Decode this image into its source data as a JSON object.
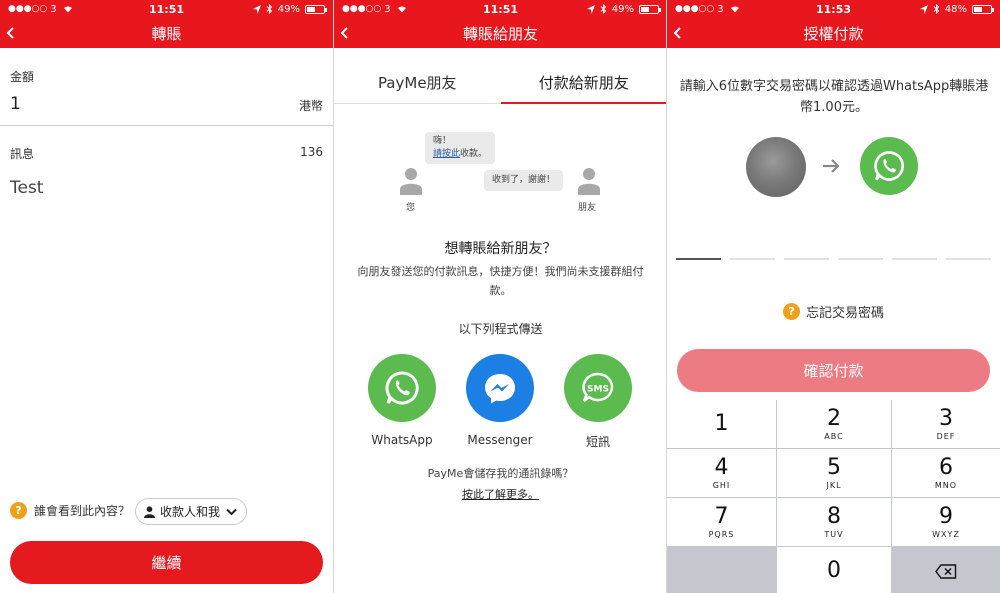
{
  "screens": [
    {
      "status": {
        "carrier": "3",
        "time": "11:51",
        "battery": "49%",
        "battery_level": 0.49
      },
      "nav_title": "轉賬",
      "amount_label": "金額",
      "amount_value": "1",
      "currency": "港幣",
      "message_label": "訊息",
      "char_count": "136",
      "message_value": "Test",
      "visibility_question": "誰會看到此內容？",
      "visibility_value": "收款人和我",
      "continue_label": "繼續"
    },
    {
      "status": {
        "carrier": "3",
        "time": "11:51",
        "battery": "49%",
        "battery_level": 0.49
      },
      "nav_title": "轉賬給朋友",
      "tabs": [
        {
          "label": "PayMe朋友",
          "active": false
        },
        {
          "label": "付款給新朋友",
          "active": true
        }
      ],
      "illustration": {
        "bubble1_line1": "嗨！",
        "bubble1_link": "請按此",
        "bubble1_rest": "收款。",
        "bubble2": "收到了，謝謝！",
        "you_label": "您",
        "friend_label": "朋友"
      },
      "heading": "想轉賬給新朋友？",
      "description": "向朋友發送您的付款訊息，快捷方便！我們尚未支援群組付款。",
      "send_via": "以下列程式傳送",
      "apps": [
        {
          "name": "WhatsApp",
          "color": "#5cbb4f",
          "icon": "whatsapp-icon"
        },
        {
          "name": "Messenger",
          "color": "#1b7fe3",
          "icon": "messenger-icon"
        },
        {
          "name": "短訊",
          "color": "#5cbb4f",
          "icon": "sms-icon",
          "badge": "SMS"
        }
      ],
      "contacts_question": "PayMe會儲存我的通訊錄嗎？",
      "learn_more": "按此了解更多。"
    },
    {
      "status": {
        "carrier": "3",
        "time": "11:53",
        "battery": "48%",
        "battery_level": 0.48
      },
      "nav_title": "授權付款",
      "prompt": "請輸入6位數字交易密碼以確認透過WhatsApp轉賬港幣1.00元。",
      "forgot": "忘記交易密碼",
      "confirm_label": "確認付款",
      "keys": [
        {
          "digit": "1",
          "letters": ""
        },
        {
          "digit": "2",
          "letters": "ABC"
        },
        {
          "digit": "3",
          "letters": "DEF"
        },
        {
          "digit": "4",
          "letters": "GHI"
        },
        {
          "digit": "5",
          "letters": "JKL"
        },
        {
          "digit": "6",
          "letters": "MNO"
        },
        {
          "digit": "7",
          "letters": "PQRS"
        },
        {
          "digit": "8",
          "letters": "TUV"
        },
        {
          "digit": "9",
          "letters": "WXYZ"
        },
        {
          "digit": "0",
          "letters": ""
        }
      ]
    }
  ],
  "colors": {
    "brand_red": "#e8161d",
    "button_red": "#e41a1e",
    "button_disabled": "#ed7b84",
    "whatsapp_green": "#5cbb4f",
    "messenger_blue": "#1b7fe3",
    "help_orange": "#f0a11a"
  }
}
